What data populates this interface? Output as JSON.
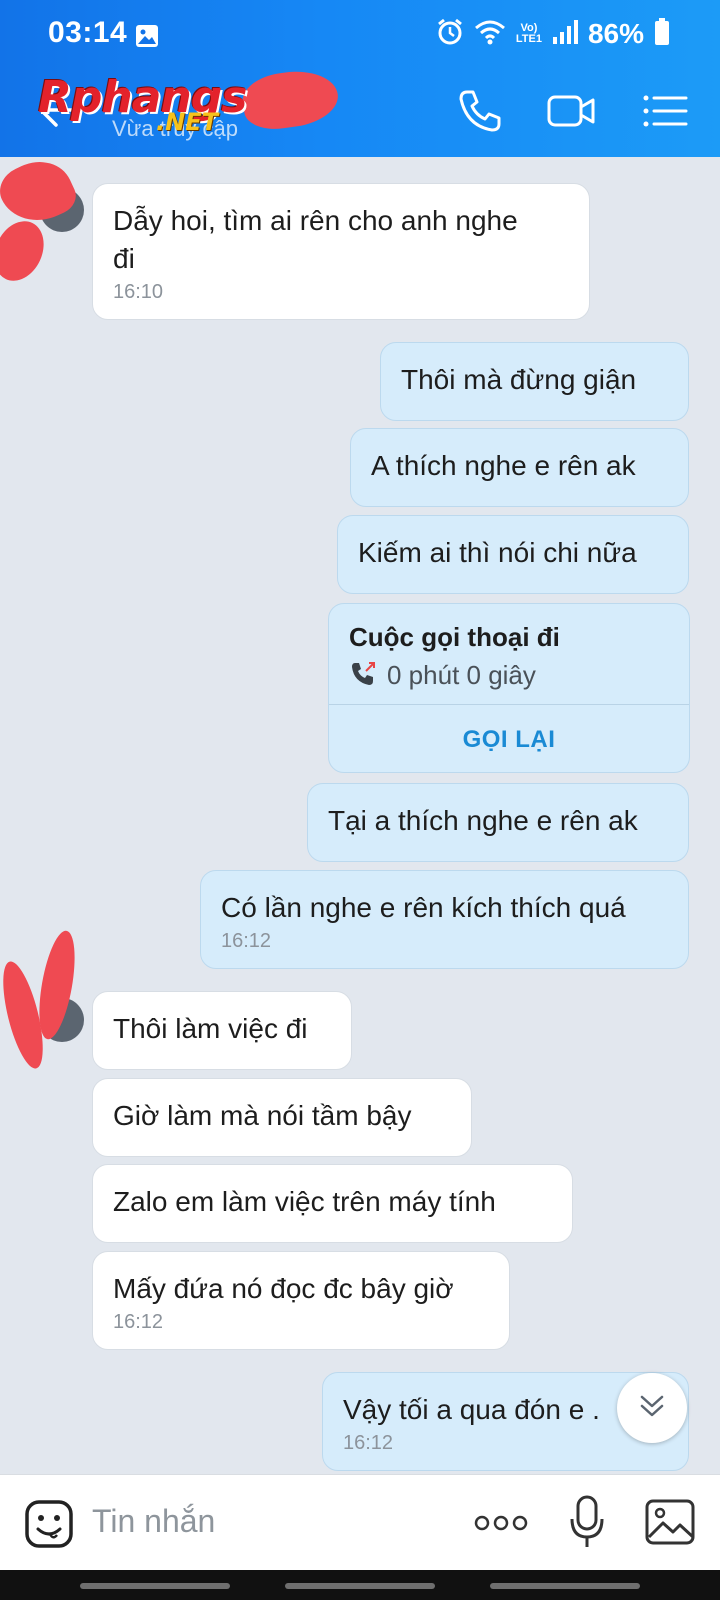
{
  "status_bar": {
    "time": "03:14",
    "volte_top": "Vo)",
    "volte_bottom": "LTE1",
    "battery": "86%"
  },
  "header": {
    "contact_status": "Vừa truy cập",
    "logo_main": "Rphangs",
    "logo_sub": ".NET",
    "icons": [
      "back-arrow-icon",
      "phone-icon",
      "video-call-icon",
      "menu-icon"
    ],
    "color": "#1688f5"
  },
  "messages": [
    {
      "side": "in",
      "text_line1": "Dẫy hoi, tìm ai rên cho anh nghe",
      "text_line2": "đi",
      "time": "16:10"
    },
    {
      "side": "out",
      "text": "Thôi mà đừng giận"
    },
    {
      "side": "out",
      "text": "A thích nghe e rên ak"
    },
    {
      "side": "out",
      "text": "Kiếm ai thì nói chi nữa"
    },
    {
      "side": "out",
      "text": "Tại a thích nghe e rên ak"
    },
    {
      "side": "out",
      "text": "Có lần nghe e rên kích thích quá",
      "time": "16:12"
    },
    {
      "side": "in",
      "text": "Thôi làm việc đi"
    },
    {
      "side": "in",
      "text": "Giờ làm mà nói tầm bậy"
    },
    {
      "side": "in",
      "text": "Zalo em làm việc trên máy tính"
    },
    {
      "side": "in",
      "text": "Mấy đứa nó đọc đc bây giờ",
      "time": "16:12"
    },
    {
      "side": "out",
      "text": "Vậy tối a qua đón e .",
      "time": "16:12"
    }
  ],
  "call_card": {
    "title": "Cuộc gọi thoại đi",
    "duration": "0 phút 0 giây",
    "action": "GỌI LẠI"
  },
  "input_bar": {
    "placeholder": "Tin nhắn",
    "more": "ooo"
  },
  "colors": {
    "incoming_bubble": "#ffffff",
    "outgoing_bubble": "#d6ecfb",
    "background": "#e2e7ee",
    "accent": "#1a8ad4",
    "redaction": "#ef4a52"
  }
}
